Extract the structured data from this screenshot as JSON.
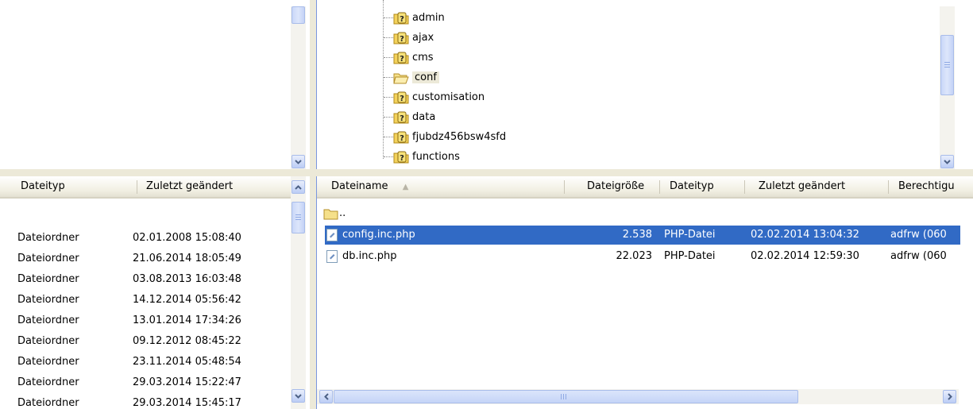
{
  "left_panel": {
    "columns": [
      {
        "label": "Dateityp"
      },
      {
        "label": "Zuletzt geändert"
      }
    ],
    "rows": [
      {
        "type": "Dateiordner",
        "modified": "02.01.2008 15:08:40"
      },
      {
        "type": "Dateiordner",
        "modified": "21.06.2014 18:05:49"
      },
      {
        "type": "Dateiordner",
        "modified": "03.08.2013 16:03:48"
      },
      {
        "type": "Dateiordner",
        "modified": "14.12.2014 05:56:42"
      },
      {
        "type": "Dateiordner",
        "modified": "13.01.2014 17:34:26"
      },
      {
        "type": "Dateiordner",
        "modified": "09.12.2012 08:45:22"
      },
      {
        "type": "Dateiordner",
        "modified": "23.11.2014 05:48:54"
      },
      {
        "type": "Dateiordner",
        "modified": "29.03.2014 15:22:47"
      },
      {
        "type": "Dateiordner",
        "modified": "29.03.2014 15:45:17"
      }
    ]
  },
  "tree": {
    "nodes": [
      {
        "label": "admin",
        "icon": "unknown-folder-icon"
      },
      {
        "label": "ajax",
        "icon": "unknown-folder-icon"
      },
      {
        "label": "cms",
        "icon": "unknown-folder-icon"
      },
      {
        "label": "conf",
        "icon": "open-folder-icon",
        "selected": true
      },
      {
        "label": "customisation",
        "icon": "unknown-folder-icon"
      },
      {
        "label": "data",
        "icon": "unknown-folder-icon"
      },
      {
        "label": "fjubdz456bsw4sfd",
        "icon": "unknown-folder-icon"
      },
      {
        "label": "functions",
        "icon": "unknown-folder-icon"
      }
    ]
  },
  "file_list": {
    "columns": [
      {
        "label": "Dateiname",
        "sort": "▲"
      },
      {
        "label": "Dateigröße"
      },
      {
        "label": "Dateityp"
      },
      {
        "label": "Zuletzt geändert"
      },
      {
        "label": "Berechtigu"
      }
    ],
    "parent_label": "..",
    "files": [
      {
        "name": "config.inc.php",
        "size": "2.538",
        "type": "PHP-Datei",
        "modified": "02.02.2014 13:04:32",
        "perms": "adfrw (060",
        "selected": true
      },
      {
        "name": "db.inc.php",
        "size": "22.023",
        "type": "PHP-Datei",
        "modified": "02.02.2014 12:59:30",
        "perms": "adfrw (060",
        "selected": false
      }
    ]
  },
  "colors": {
    "selection": "#316ac5",
    "tree_selection": "#ece9d8",
    "header_bg": "#f1efe2",
    "panel_border": "#7a96df"
  }
}
